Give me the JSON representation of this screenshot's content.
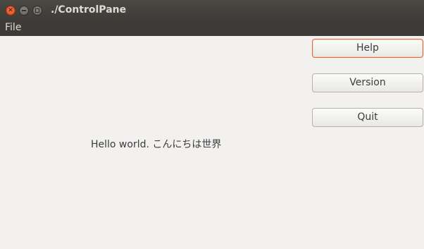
{
  "window": {
    "title": "./ControlPane"
  },
  "menubar": {
    "items": [
      {
        "label": "File"
      }
    ]
  },
  "buttons": {
    "help": "Help",
    "version": "Version",
    "quit": "Quit"
  },
  "main": {
    "message": "Hello world. こんにちは世界"
  },
  "colors": {
    "titlebar_bg": "#3c3b37",
    "content_bg": "#f2f1f0",
    "focus_border": "#e06b3a",
    "close_button": "#e9541f"
  }
}
